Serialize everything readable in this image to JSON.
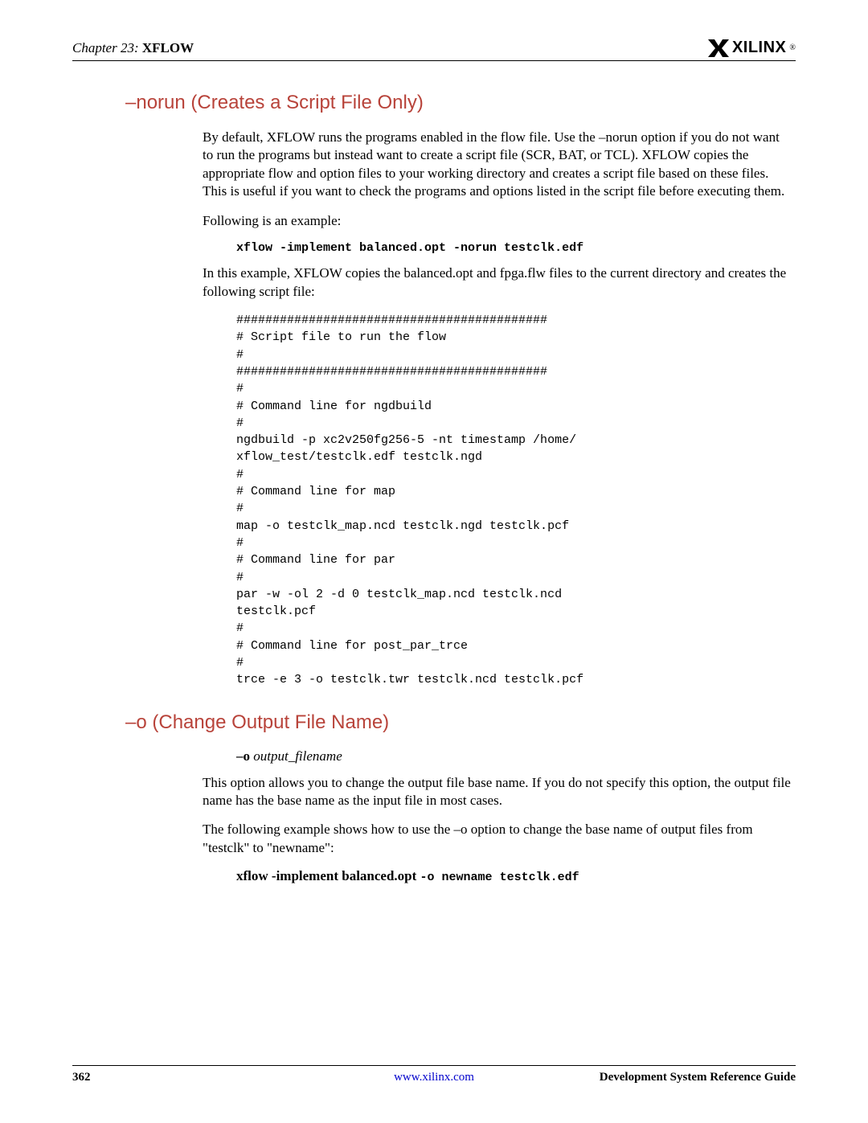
{
  "header": {
    "chapter_prefix": "Chapter 23:",
    "chapter_title": "XFLOW",
    "logo_text": "XILINX",
    "logo_reg": "®"
  },
  "section1": {
    "heading": "–norun (Creates a Script File Only)",
    "para1": "By default, XFLOW runs the programs enabled in the flow file. Use the –norun option if you do not want to run the programs but instead want to create a script file (SCR, BAT, or TCL). XFLOW copies the appropriate flow and option files to your working directory and creates a script file based on these files. This is useful if you want to check the programs and options listed in the script file before executing them.",
    "para2": "Following is an example:",
    "cmd": "xflow -implement balanced.opt -norun testclk.edf",
    "para3": "In this example, XFLOW copies the balanced.opt and fpga.flw files to the current directory and creates the following script file:",
    "script": "###########################################\n# Script file to run the flow\n#\n###########################################\n#\n# Command line for ngdbuild\n#\nngdbuild -p xc2v250fg256-5 -nt timestamp /home/\nxflow_test/testclk.edf testclk.ngd\n#\n# Command line for map\n#\nmap -o testclk_map.ncd testclk.ngd testclk.pcf\n#\n# Command line for par\n#\npar -w -ol 2 -d 0 testclk_map.ncd testclk.ncd\ntestclk.pcf\n#\n# Command line for post_par_trce\n#\ntrce -e 3 -o testclk.twr testclk.ncd testclk.pcf"
  },
  "section2": {
    "heading": "–o (Change Output File Name)",
    "syntax_bold": "–o",
    "syntax_italic": "output_filename",
    "para1": "This option allows you to change the output file base name. If you do not specify this option, the output file name has the base name as the input file in most cases.",
    "para2": "The following example shows how to use the –o option to change the base name of output files from \"testclk\" to \"newname\":",
    "cmd_serif": "xflow -implement balanced.opt ",
    "cmd_mono": "-o newname testclk.edf"
  },
  "footer": {
    "page": "362",
    "url": "www.xilinx.com",
    "guide": "Development System Reference Guide"
  }
}
